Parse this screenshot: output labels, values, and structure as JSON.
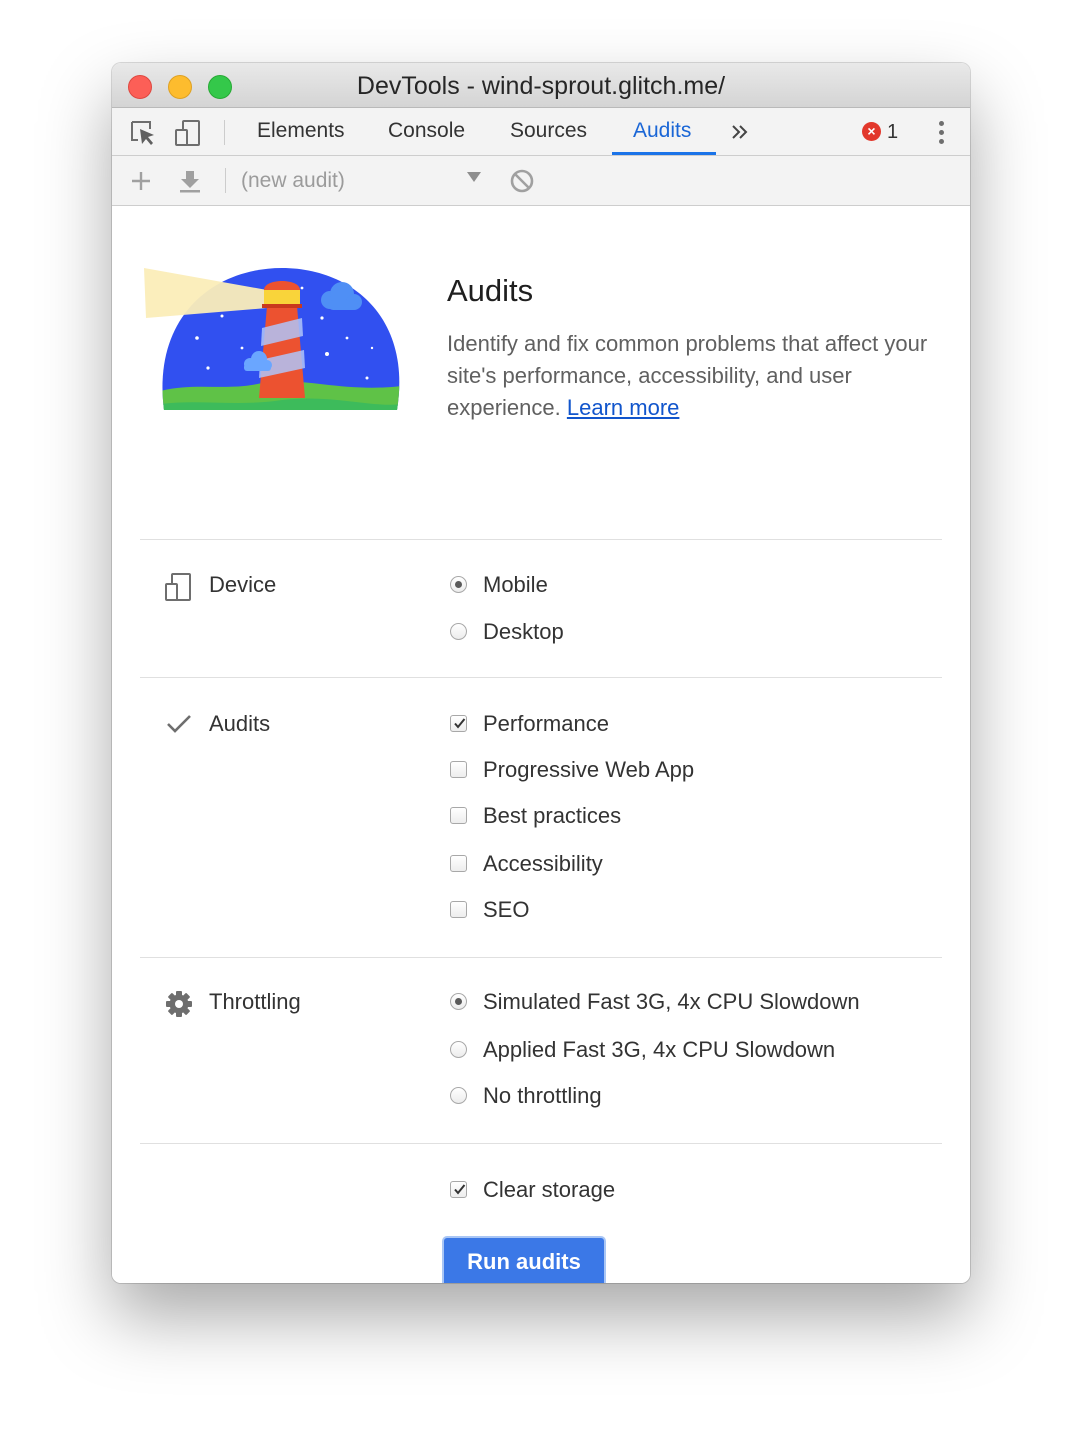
{
  "window": {
    "title": "DevTools - wind-sprout.glitch.me/"
  },
  "tabbar": {
    "tabs": [
      {
        "label": "Elements"
      },
      {
        "label": "Console"
      },
      {
        "label": "Sources"
      },
      {
        "label": "Audits",
        "active": true
      }
    ],
    "more_icon": "chevron-double-right",
    "error_count": "1",
    "icons": [
      "inspect-element-icon",
      "device-toggle-icon",
      "error-icon",
      "more-vert-icon"
    ]
  },
  "toolbar": {
    "audit_select": "(new audit)",
    "icons": [
      "add-icon",
      "download-icon",
      "dropdown-arrow-icon",
      "clear-block-icon"
    ]
  },
  "hero": {
    "title": "Audits",
    "description": "Identify and fix common problems that affect your site's performance, accessibility, and user experience.",
    "link": "Learn more",
    "illustration": "lighthouse-illustration"
  },
  "device": {
    "label": "Device",
    "options": [
      {
        "label": "Mobile",
        "checked": true
      },
      {
        "label": "Desktop",
        "checked": false
      }
    ]
  },
  "audits": {
    "label": "Audits",
    "options": [
      {
        "label": "Performance",
        "checked": true
      },
      {
        "label": "Progressive Web App",
        "checked": false
      },
      {
        "label": "Best practices",
        "checked": false
      },
      {
        "label": "Accessibility",
        "checked": false
      },
      {
        "label": "SEO",
        "checked": false
      }
    ]
  },
  "throttling": {
    "label": "Throttling",
    "options": [
      {
        "label": "Simulated Fast 3G, 4x CPU Slowdown",
        "checked": true
      },
      {
        "label": "Applied Fast 3G, 4x CPU Slowdown",
        "checked": false
      },
      {
        "label": "No throttling",
        "checked": false
      }
    ]
  },
  "clear_storage": {
    "label": "Clear storage",
    "checked": true
  },
  "run_button": "Run audits",
  "colors": {
    "accent": "#1a73e8",
    "button": "#3b78e7",
    "link": "#1155cc"
  }
}
